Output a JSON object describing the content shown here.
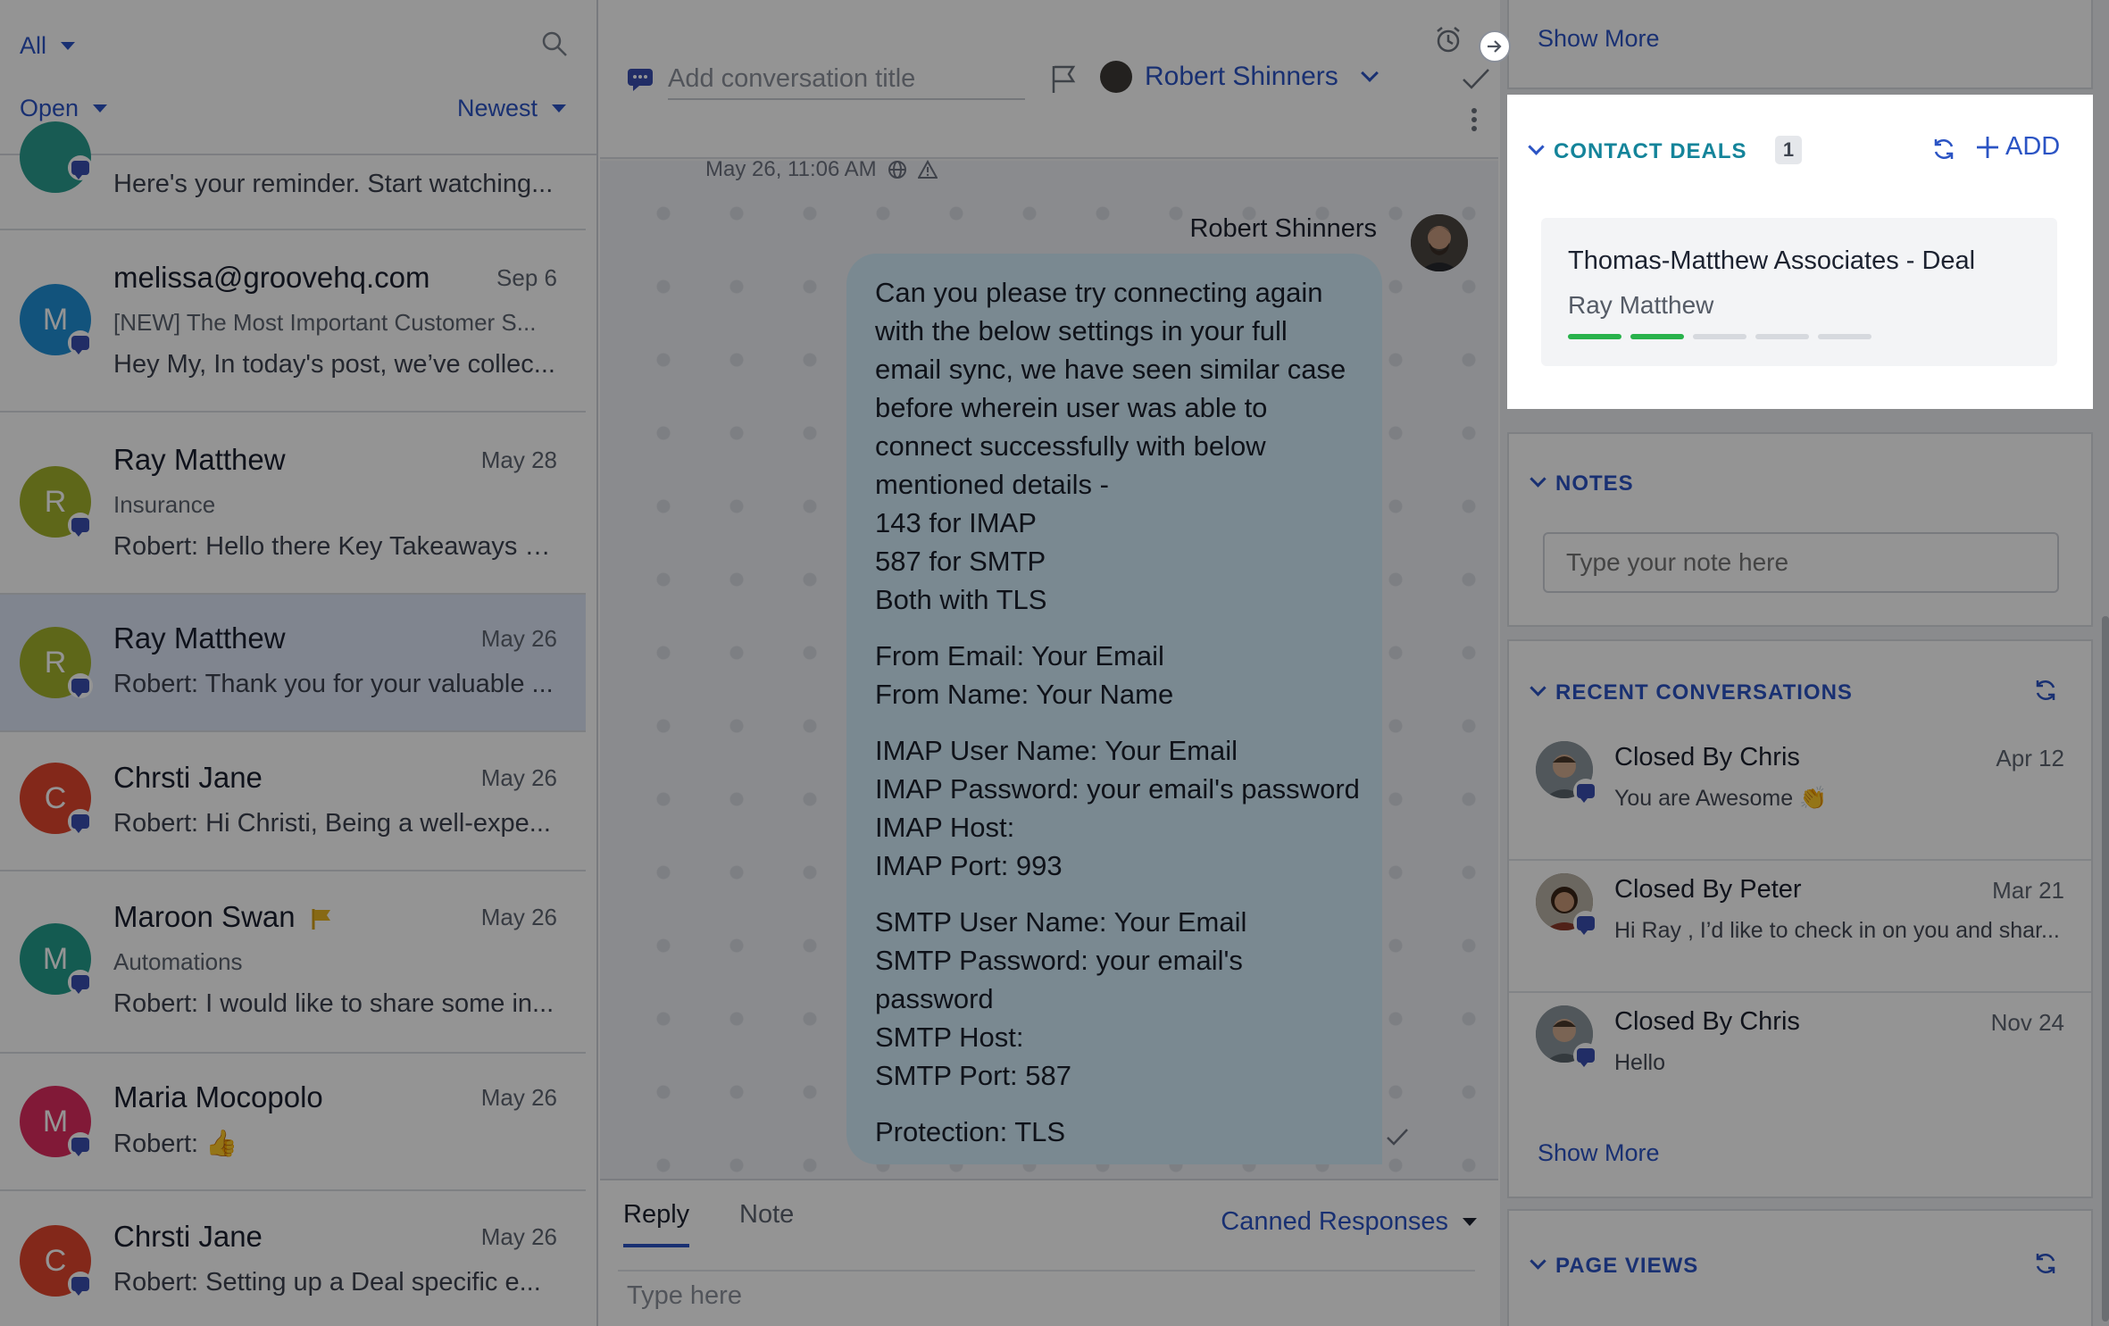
{
  "left_panel": {
    "filter_label": "All",
    "status_label": "Open",
    "sort_label": "Newest",
    "icons": {
      "search": "search-icon"
    },
    "conversations": [
      {
        "name": "",
        "date": "",
        "subject": "",
        "preview": "Here's your reminder. Start watching...",
        "initial": "",
        "color": "#2a9d8f"
      },
      {
        "name": "melissa@groovehq.com",
        "date": "Sep 6",
        "subject": "[NEW] The Most Important Customer S...",
        "preview": "Hey My, In today's post, we’ve collec...",
        "initial": "M",
        "color": "#1f8fd6"
      },
      {
        "name": "Ray Matthew",
        "date": "May 28",
        "subject": "Insurance",
        "preview": "Robert: Hello there Key Takeaways o...",
        "initial": "R",
        "color": "#a3b12b"
      },
      {
        "name": "Ray Matthew",
        "date": "May 26",
        "subject": "",
        "preview": "Robert: Thank you for your valuable ...",
        "initial": "R",
        "color": "#a3b12b"
      },
      {
        "name": "Chrsti Jane",
        "date": "May 26",
        "subject": "",
        "preview": "Robert: Hi Christi, Being a well-expe...",
        "initial": "C",
        "color": "#e2452e"
      },
      {
        "name": "Maroon Swan",
        "date": "May 26",
        "subject": "Automations",
        "preview": "Robert: I would like to share some in...",
        "initial": "M",
        "color": "#239e8c"
      },
      {
        "name": "Maria Mocopolo",
        "date": "May 26",
        "subject": "",
        "preview": "Robert: 👍",
        "initial": "M",
        "color": "#df2c5f"
      },
      {
        "name": "Chrsti Jane",
        "date": "May 26",
        "subject": "",
        "preview": "Robert: Setting up a Deal specific e...",
        "initial": "C",
        "color": "#e2452e"
      }
    ]
  },
  "chat": {
    "title_placeholder": "Add conversation title",
    "assignee": "Robert Shinners",
    "timestamp": "May 26, 11:06 AM",
    "sender": "Robert Shinners",
    "message_paragraphs": [
      [
        "Can you please try connecting again",
        "with the below settings in your full",
        "email sync, we have seen similar case",
        "before wherein user was able to",
        "connect successfully with below",
        "mentioned details -",
        "143 for IMAP",
        "587 for SMTP",
        "Both with TLS"
      ],
      [
        "From Email: Your Email",
        "From Name: Your Name"
      ],
      [
        "IMAP User Name: Your Email",
        "IMAP Password: your email's password",
        "IMAP Host:",
        "IMAP Port: 993"
      ],
      [
        "SMTP User Name: Your Email",
        "SMTP Password: your email's",
        "password",
        "SMTP Host:",
        "SMTP Port: 587"
      ],
      [
        "Protection: TLS"
      ]
    ],
    "tabs": {
      "reply": "Reply",
      "note": "Note"
    },
    "canned_responses": "Canned Responses",
    "compose_placeholder": "Type here"
  },
  "sidebar": {
    "top_show_more": "Show More",
    "contact_deals": {
      "title": "CONTACT DEALS",
      "count": "1",
      "add_label": "ADD",
      "deal_name": "Thomas-Matthew Associates - Deal",
      "deal_contact": "Ray Matthew",
      "stage_progress": "2 of 5"
    },
    "notes": {
      "title": "NOTES",
      "placeholder": "Type your note here"
    },
    "recent_conversations": {
      "title": "RECENT CONVERSATIONS",
      "items": [
        {
          "title": "Closed By Chris",
          "date": "Apr 12",
          "preview": "You are Awesome 👏"
        },
        {
          "title": "Closed By Peter",
          "date": "Mar 21",
          "preview": "Hi Ray , I’d like to check in on you and shar..."
        },
        {
          "title": "Closed By Chris",
          "date": "Nov 24",
          "preview": "Hello"
        }
      ],
      "show_more": "Show More"
    },
    "page_views": {
      "title": "PAGE VIEWS"
    }
  },
  "colors": {
    "accent": "#2b54c4",
    "deal_title": "#14849a",
    "progress_done": "#28b24b",
    "progress_todo": "#d6d9de"
  }
}
